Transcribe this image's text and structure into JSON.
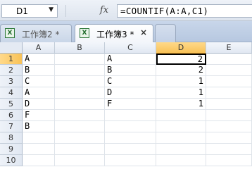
{
  "formula_bar": {
    "name_box": "D1",
    "fx_label": "fx",
    "formula": "=COUNTIF(A:A,C1)"
  },
  "tabs": [
    {
      "label": "工作簿2 *",
      "active": false
    },
    {
      "label": "工作簿3 *",
      "active": true,
      "close": "×"
    }
  ],
  "sheet": {
    "columns": [
      "A",
      "B",
      "C",
      "D",
      "E"
    ],
    "rows": [
      "1",
      "2",
      "3",
      "4",
      "5",
      "6",
      "7",
      "8",
      "9",
      "10"
    ],
    "active_cell": "D1",
    "cells": {
      "A": [
        "A",
        "B",
        "C",
        "A",
        "D",
        "F",
        "B",
        "",
        "",
        ""
      ],
      "B": [
        "",
        "",
        "",
        "",
        "",
        "",
        "",
        "",
        "",
        ""
      ],
      "C": [
        "A",
        "B",
        "C",
        "D",
        "F",
        "",
        "",
        "",
        "",
        ""
      ],
      "D": [
        "2",
        "2",
        "1",
        "1",
        "1",
        "",
        "",
        "",
        "",
        ""
      ],
      "E": [
        "",
        "",
        "",
        "",
        "",
        "",
        "",
        "",
        "",
        ""
      ]
    }
  }
}
